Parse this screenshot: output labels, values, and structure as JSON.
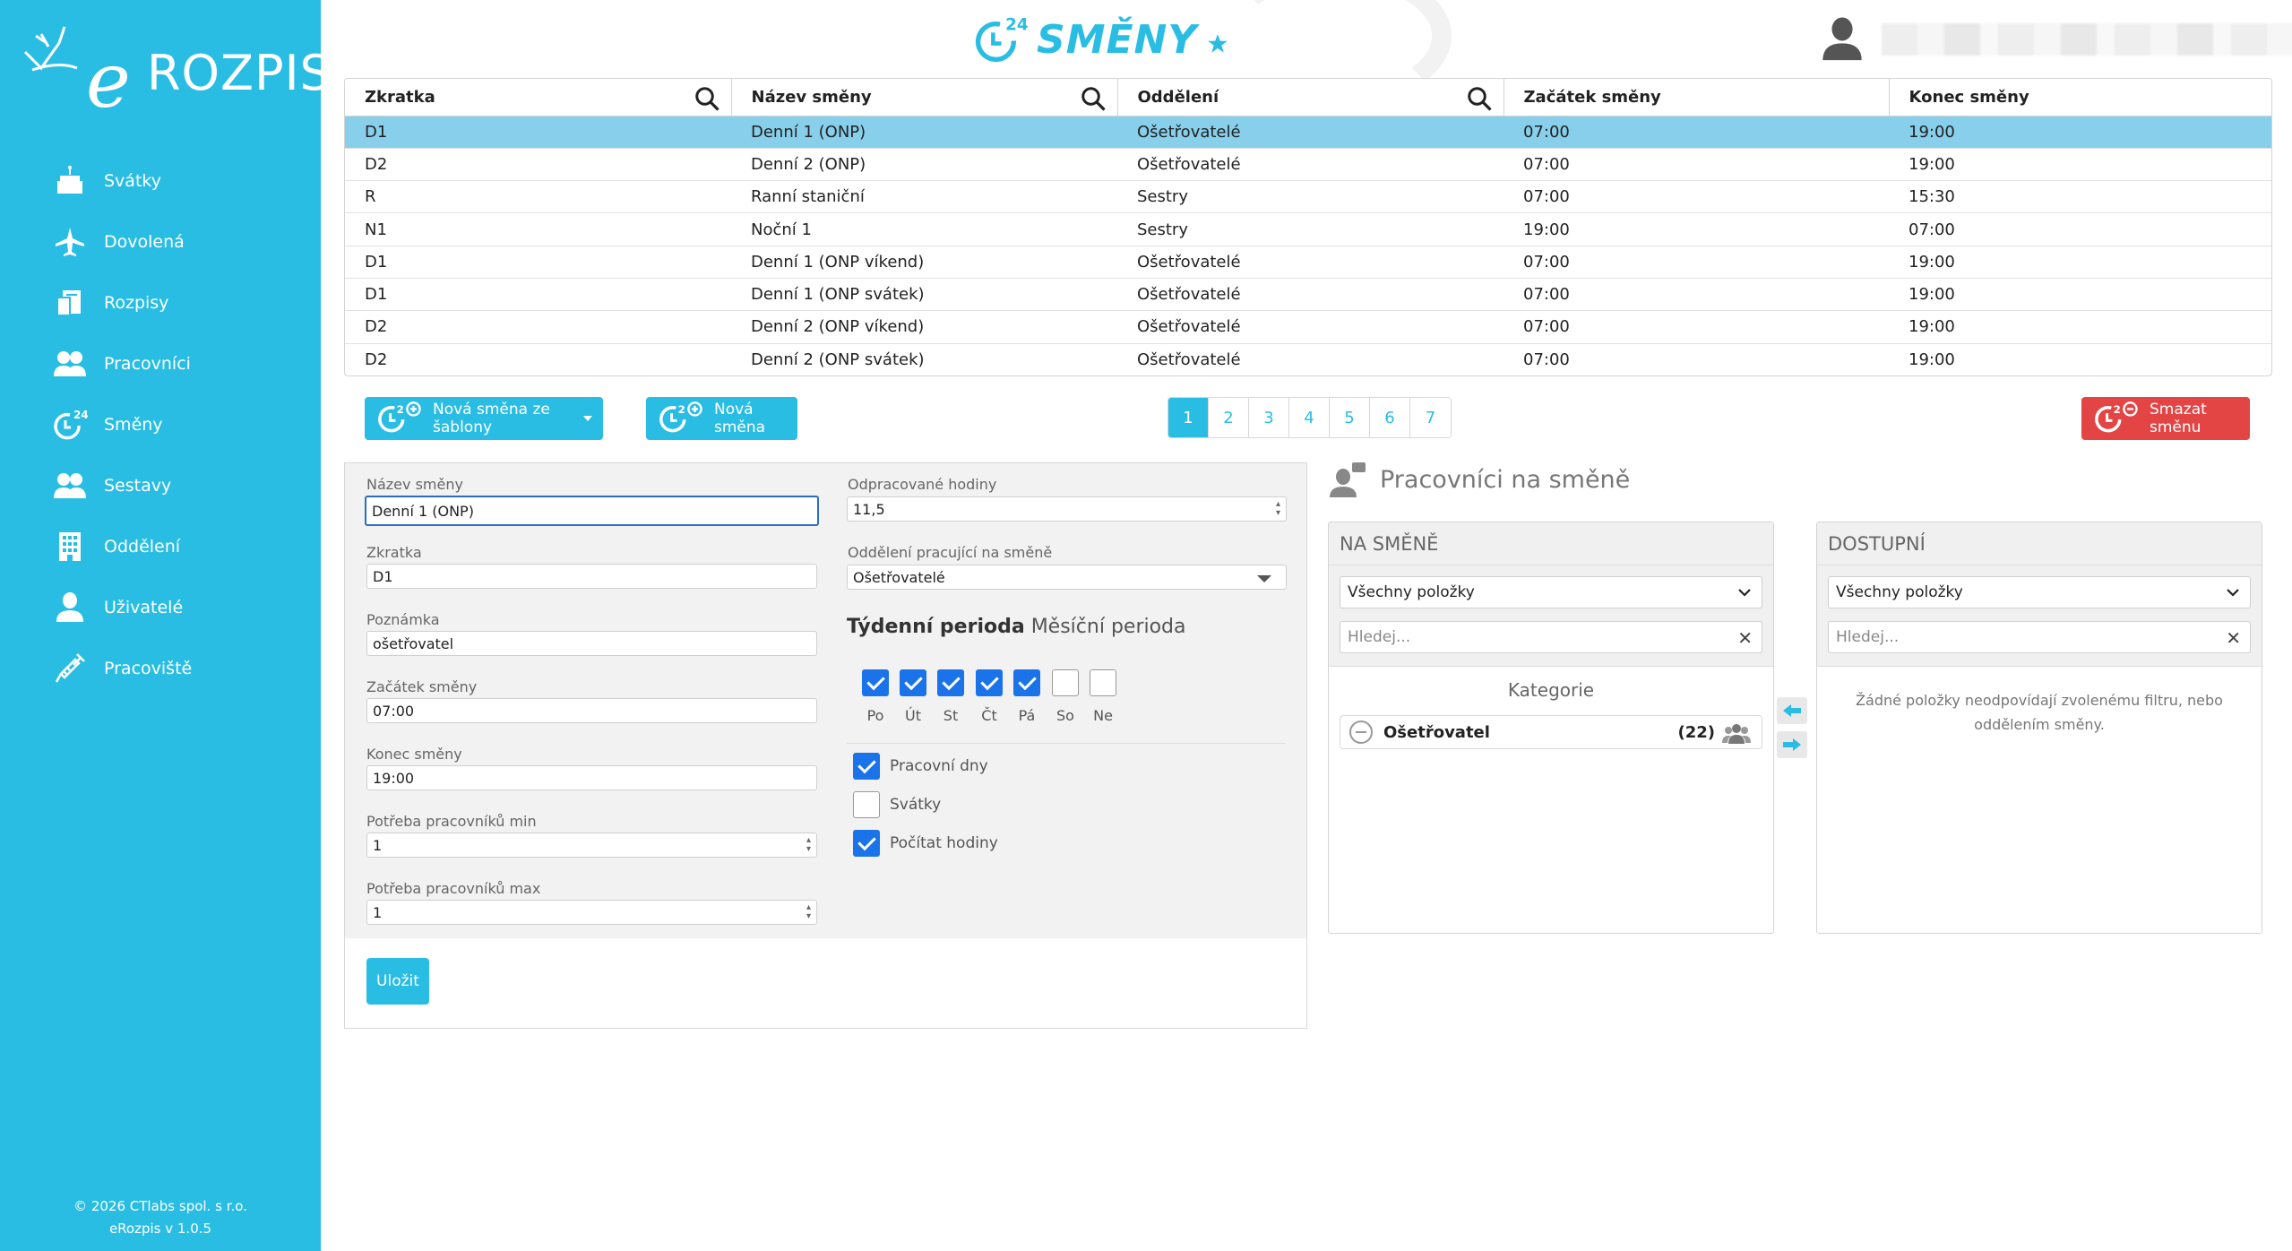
{
  "app": {
    "logo_text": "ROZPIS",
    "logo_e": "e",
    "module_title": "SMĚNY",
    "footer_copyright": "© 2026 CTlabs spol. s r.o.",
    "footer_version": "eRozpis v 1.0.5"
  },
  "sidebar": {
    "items": [
      {
        "label": "Svátky",
        "icon": "cake-icon"
      },
      {
        "label": "Dovolená",
        "icon": "airplane-icon"
      },
      {
        "label": "Rozpisy",
        "icon": "schedule-icon"
      },
      {
        "label": "Pracovníci",
        "icon": "workers-icon"
      },
      {
        "label": "Směny",
        "icon": "shifts-24-icon"
      },
      {
        "label": "Sestavy",
        "icon": "teams-icon"
      },
      {
        "label": "Oddělení",
        "icon": "building-icon"
      },
      {
        "label": "Uživatelé",
        "icon": "user-icon"
      },
      {
        "label": "Pracoviště",
        "icon": "syringe-icon"
      }
    ]
  },
  "table": {
    "headers": [
      "Zkratka",
      "Název směny",
      "Oddělení",
      "Začátek směny",
      "Konec směny"
    ],
    "rows": [
      [
        "D1",
        "Denní 1 (ONP)",
        "Ošetřovatelé",
        "07:00",
        "19:00"
      ],
      [
        "D2",
        "Denní 2 (ONP)",
        "Ošetřovatelé",
        "07:00",
        "19:00"
      ],
      [
        "R",
        "Ranní staniční",
        "Sestry",
        "07:00",
        "15:30"
      ],
      [
        "N1",
        "Noční 1",
        "Sestry",
        "19:00",
        "07:00"
      ],
      [
        "D1",
        "Denní 1 (ONP víkend)",
        "Ošetřovatelé",
        "07:00",
        "19:00"
      ],
      [
        "D1",
        "Denní 1 (ONP svátek)",
        "Ošetřovatelé",
        "07:00",
        "19:00"
      ],
      [
        "D2",
        "Denní 2 (ONP víkend)",
        "Ošetřovatelé",
        "07:00",
        "19:00"
      ],
      [
        "D2",
        "Denní 2 (ONP svátek)",
        "Ošetřovatelé",
        "07:00",
        "19:00"
      ]
    ],
    "selected_row": 0
  },
  "actions": {
    "new_from_template": "Nová směna ze šablony",
    "new_shift": "Nová směna",
    "delete_shift": "Smazat směnu"
  },
  "pagination": {
    "pages": [
      "1",
      "2",
      "3",
      "4",
      "5",
      "6",
      "7"
    ],
    "current": "1"
  },
  "form": {
    "name_label": "Název směny",
    "name_value": "Denní 1 (ONP)",
    "abbr_label": "Zkratka",
    "abbr_value": "D1",
    "note_label": "Poznámka",
    "note_value": "ošetřovatel",
    "start_label": "Začátek směny",
    "start_value": "07:00",
    "end_label": "Konec směny",
    "end_value": "19:00",
    "min_label": "Potřeba pracovníků min",
    "min_value": "1",
    "max_label": "Potřeba pracovníků max",
    "max_value": "1",
    "hours_label": "Odpracované hodiny",
    "hours_value": "11,5",
    "dept_label": "Oddělení pracující na směně",
    "dept_value": "Ošetřovatelé",
    "period_weekly": "Týdenní perioda",
    "period_monthly": "Měsíční perioda",
    "days": [
      {
        "label": "Po",
        "checked": true
      },
      {
        "label": "Út",
        "checked": true
      },
      {
        "label": "St",
        "checked": true
      },
      {
        "label": "Čt",
        "checked": true
      },
      {
        "label": "Pá",
        "checked": true
      },
      {
        "label": "So",
        "checked": false
      },
      {
        "label": "Ne",
        "checked": false
      }
    ],
    "options": [
      {
        "label": "Pracovní dny",
        "checked": true
      },
      {
        "label": "Svátky",
        "checked": false
      },
      {
        "label": "Počítat hodiny",
        "checked": true
      }
    ],
    "save": "Uložit"
  },
  "workers": {
    "title": "Pracovníci na směně",
    "on_shift": {
      "header": "NA SMĚNĚ",
      "filter": "Všechny položky",
      "search_placeholder": "Hledej...",
      "category_title": "Kategorie",
      "category_name": "Ošetřovatel",
      "category_count": "(22)"
    },
    "available": {
      "header": "DOSTUPNÍ",
      "filter": "Všechny položky",
      "search_placeholder": "Hledej...",
      "empty_message": "Žádné položky neodpovídají zvolenému filtru, nebo oddělením směny."
    }
  },
  "colors": {
    "primary": "#29bde4",
    "selected_row": "#87cfea",
    "danger": "#e34444",
    "checkbox": "#1a73e8"
  }
}
